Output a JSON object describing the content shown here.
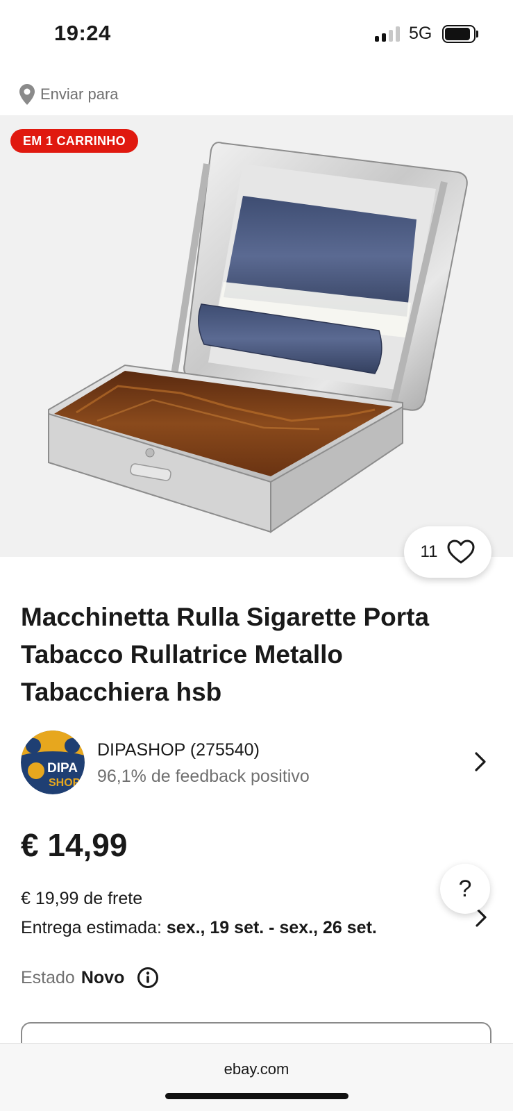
{
  "status_bar": {
    "time": "19:24",
    "network": "5G",
    "signal_bars_active": 2,
    "signal_bars_total": 4,
    "battery_level": 0.85
  },
  "ship_to": {
    "label": "Enviar para",
    "icon": "location-pin-icon"
  },
  "listing": {
    "cart_badge": "EM 1 CARRINHO",
    "watch_count": "11",
    "title": "Macchinetta Rulla Sigarette Porta Tabacco Rullatrice Metallo Tabacchiera hsb"
  },
  "seller": {
    "name": "DIPASHOP (275540)",
    "feedback": "96,1% de feedback positivo",
    "logo_text_top": "DIPA",
    "logo_text_bottom": "SHOP"
  },
  "price": {
    "value": "€ 14,99"
  },
  "shipping": {
    "text": "€ 19,99 de frete",
    "delivery_label": "Entrega estimada:",
    "delivery_dates": "sex., 19 set. - sex., 26 set."
  },
  "condition": {
    "label": "Estado",
    "value": "Novo"
  },
  "help": {
    "label": "?"
  },
  "browser": {
    "url": "ebay.com"
  },
  "colors": {
    "badge_red": "#e0190f",
    "text_primary": "#191919",
    "text_secondary": "#707070",
    "hero_bg": "#f1f1f1"
  }
}
